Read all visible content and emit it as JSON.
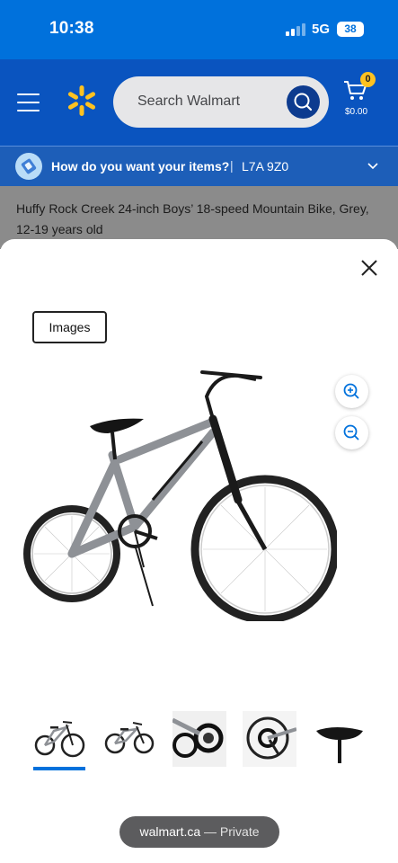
{
  "status": {
    "time": "10:38",
    "network": "5G",
    "battery": "38"
  },
  "header": {
    "search_placeholder": "Search Walmart",
    "cart_count": "0",
    "cart_total": "$0.00",
    "brand_color": "#0a54bf",
    "accent_color": "#ffc220"
  },
  "delivery": {
    "question": "How do you want your items?",
    "separator": "|",
    "postal_code": "L7A 9Z0"
  },
  "product": {
    "title": "Huffy Rock Creek 24-inch Boys’ 18-speed Mountain Bike, Grey, 12-19 years old"
  },
  "viewer": {
    "tag_label": "Images",
    "thumbnails": [
      "bike-side-view",
      "bike-angle-view",
      "gears-closeup",
      "rear-derailleur-closeup",
      "saddle-closeup"
    ],
    "selected_thumbnail": 0
  },
  "browser": {
    "domain": "walmart.ca",
    "mode": "— Private"
  }
}
